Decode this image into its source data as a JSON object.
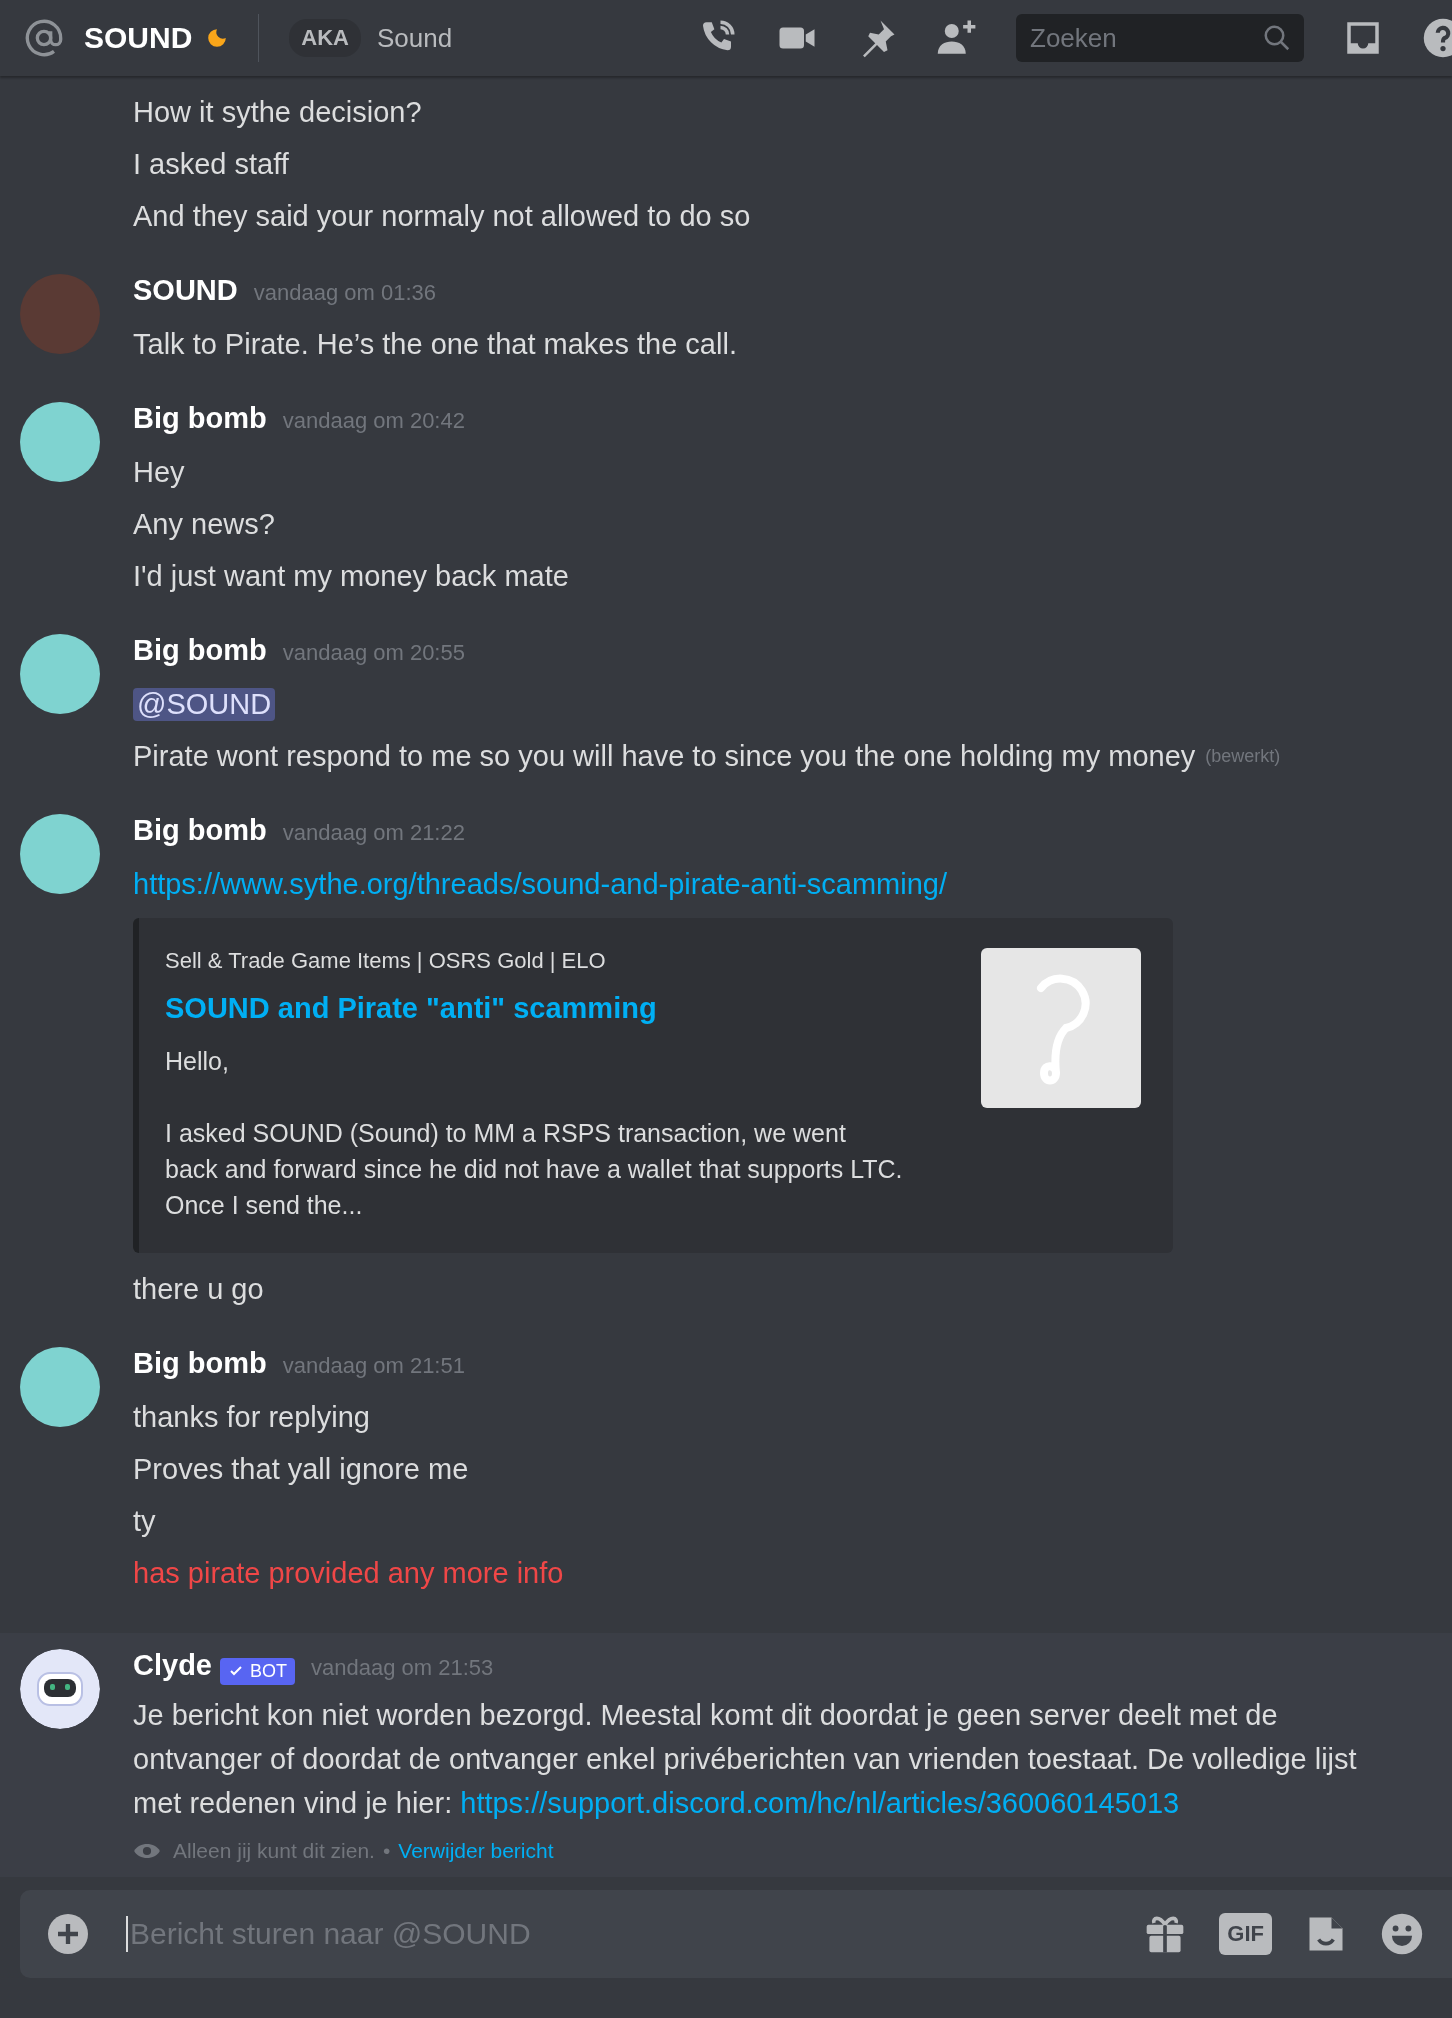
{
  "header": {
    "title": "SOUND",
    "aka_label": "AKA",
    "nickname": "Sound",
    "search_placeholder": "Zoeken"
  },
  "messages": [
    {
      "kind": "continuation",
      "highlighted": false,
      "lines": [
        {
          "kind": "text",
          "text": "How it sythe decision?",
          "failed": false
        },
        {
          "kind": "text",
          "text": "I asked staff",
          "failed": false
        },
        {
          "kind": "text",
          "text": "And they said your normaly not allowed to do so",
          "failed": false
        }
      ]
    },
    {
      "author": "SOUND",
      "timestamp": "vandaag om 01:36",
      "kind": "photo",
      "highlighted": false,
      "lines": [
        {
          "kind": "text",
          "text": "Talk to Pirate. He’s the one that makes the call.",
          "failed": false
        }
      ]
    },
    {
      "author": "Big bomb",
      "timestamp": "vandaag om 20:42",
      "kind": "cartoon",
      "highlighted": false,
      "lines": [
        {
          "kind": "text",
          "text": "Hey",
          "failed": false
        },
        {
          "kind": "text",
          "text": "Any news?",
          "failed": false
        },
        {
          "kind": "text",
          "text": "I'd just want my money back mate",
          "failed": false
        }
      ]
    },
    {
      "author": "Big bomb",
      "timestamp": "vandaag om 20:55",
      "kind": "cartoon",
      "highlighted": false,
      "lines": [
        {
          "kind": "mention",
          "text": "@SOUND",
          "failed": false
        },
        {
          "kind": "text",
          "text": "Pirate wont respond to me so you will have to since you the one holding my money",
          "edited": "(bewerkt)",
          "failed": false
        }
      ]
    },
    {
      "author": "Big bomb",
      "timestamp": "vandaag om 21:22",
      "kind": "cartoon",
      "highlighted": false,
      "lines": [
        {
          "kind": "link",
          "text": "https://www.sythe.org/threads/sound-and-pirate-anti-scamming/",
          "failed": false
        },
        {
          "kind": "embed",
          "provider": "Sell & Trade Game Items | OSRS Gold | ELO",
          "title": "SOUND and Pirate \"anti\" scamming",
          "paragraphs": [
            "Hello,",
            "I asked SOUND (Sound) to MM a RSPS transaction, we went back and forward since he did not have a wallet that supports LTC. Once I send the..."
          ],
          "failed": false
        },
        {
          "kind": "text",
          "text": "there u go",
          "failed": false
        }
      ]
    },
    {
      "author": "Big bomb",
      "timestamp": "vandaag om 21:51",
      "kind": "cartoon",
      "highlighted": false,
      "lines": [
        {
          "kind": "text",
          "text": "thanks for replying",
          "failed": false
        },
        {
          "kind": "text",
          "text": "Proves that yall ignore me",
          "failed": false
        },
        {
          "kind": "text",
          "text": "ty",
          "failed": false
        },
        {
          "kind": "text",
          "text": "has pirate provided any more info",
          "failed": true
        }
      ]
    },
    {
      "author": "Clyde",
      "badge": "BOT",
      "timestamp": "vandaag om 21:53",
      "kind": "bot",
      "highlighted": true,
      "lines": [
        {
          "kind": "paragraph",
          "text": "Je bericht kon niet worden bezorgd. Meestal komt dit doordat je geen server deelt met de ontvanger of doordat de ontvanger enkel privéberichten van vrienden toestaat. De volledige lijst met redenen vind je hier:",
          "link": "https://support.discord.com/hc/nl/articles/360060145013",
          "failed": false
        }
      ],
      "footer": {
        "note": "Alleen jij kunt dit zien.",
        "separator": "•",
        "action": "Verwijder bericht"
      }
    }
  ],
  "composer": {
    "placeholder": "Bericht sturen naar @SOUND",
    "gif_label": "GIF"
  }
}
